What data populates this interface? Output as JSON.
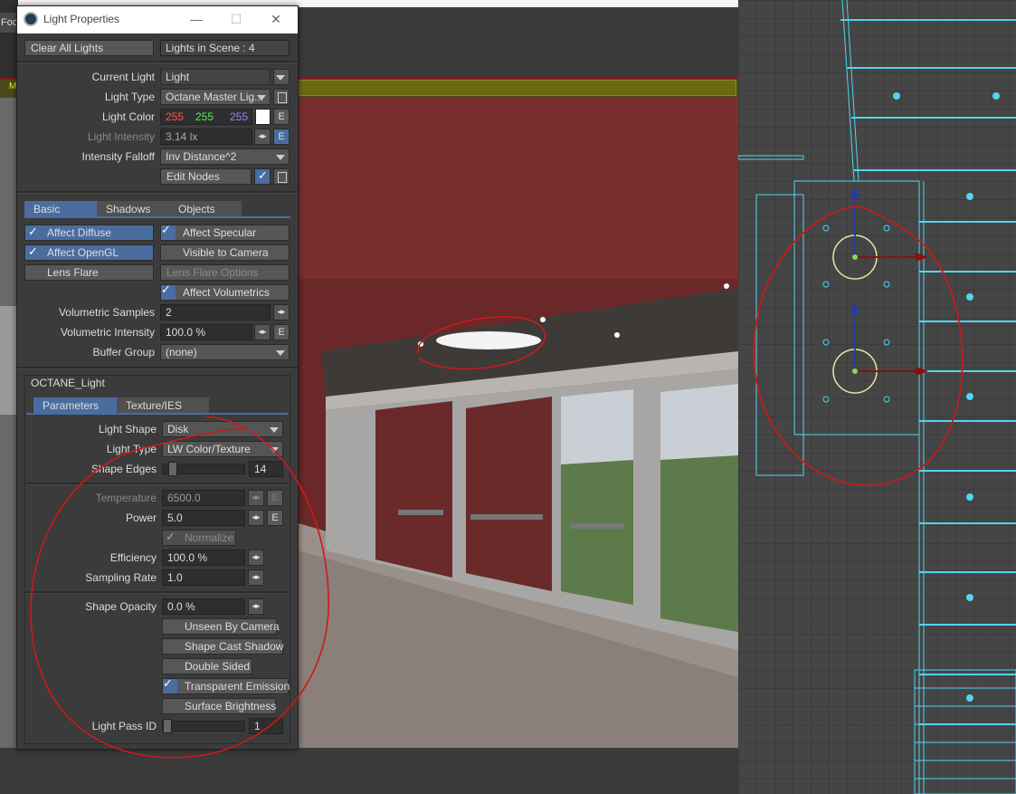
{
  "background": {
    "fo_label": "Foc",
    "render_m": "M"
  },
  "window": {
    "title": "Light Properties",
    "min": "—",
    "max": "☐",
    "close": "✕"
  },
  "top": {
    "clear_all_lights": "Clear All Lights",
    "lights_in_scene": "Lights in Scene : 4",
    "current_light_label": "Current Light",
    "current_light_value": "Light",
    "light_type_label": "Light Type",
    "light_type_value": "Octane Master Lig...",
    "light_color_label": "Light Color",
    "color_r": "255",
    "color_g": "255",
    "color_b": "255",
    "light_intensity_label": "Light Intensity",
    "light_intensity_value": "3.14 lx",
    "falloff_label": "Intensity Falloff",
    "falloff_value": "Inv Distance^2",
    "edit_nodes": "Edit Nodes",
    "e": "E"
  },
  "tabs": [
    "Basic",
    "Shadows",
    "Objects"
  ],
  "basic": {
    "affect_diffuse": "Affect Diffuse",
    "affect_specular": "Affect Specular",
    "affect_opengl": "Affect OpenGL",
    "visible_to_camera": "Visible to Camera",
    "lens_flare": "Lens Flare",
    "lens_flare_options": "Lens Flare Options",
    "affect_volumetrics": "Affect Volumetrics",
    "vol_samples_label": "Volumetric Samples",
    "vol_samples_value": "2",
    "vol_intensity_label": "Volumetric Intensity",
    "vol_intensity_value": "100.0 %",
    "buffer_group_label": "Buffer Group",
    "buffer_group_value": "(none)"
  },
  "octane": {
    "header": "OCTANE_Light",
    "tabs": [
      "Parameters",
      "Texture/IES"
    ],
    "light_shape_label": "Light Shape",
    "light_shape_value": "Disk",
    "light_type_label": "Light Type",
    "light_type_value": "LW Color/Texture",
    "shape_edges_label": "Shape Edges",
    "shape_edges_value": "14",
    "shape_edges_level": 0.08,
    "temperature_label": "Temperature",
    "temperature_value": "6500.0",
    "power_label": "Power",
    "power_value": "5.0",
    "normalize": "Normalize",
    "efficiency_label": "Efficiency",
    "efficiency_value": "100.0 %",
    "sampling_rate_label": "Sampling Rate",
    "sampling_rate_value": "1.0",
    "shape_opacity_label": "Shape Opacity",
    "shape_opacity_value": "0.0 %",
    "unseen_by_camera": "Unseen By Camera",
    "shape_cast_shadow": "Shape Cast Shadow",
    "double_sided": "Double Sided",
    "transparent_emission": "Transparent Emission",
    "surface_brightness": "Surface Brightness",
    "light_pass_id_label": "Light Pass ID",
    "light_pass_id_value": "1",
    "light_pass_id_level": 0.0
  },
  "colors": {
    "accent": "#4a6da0",
    "annotation": "#d01818",
    "wireframe": "#4fd6f0"
  }
}
